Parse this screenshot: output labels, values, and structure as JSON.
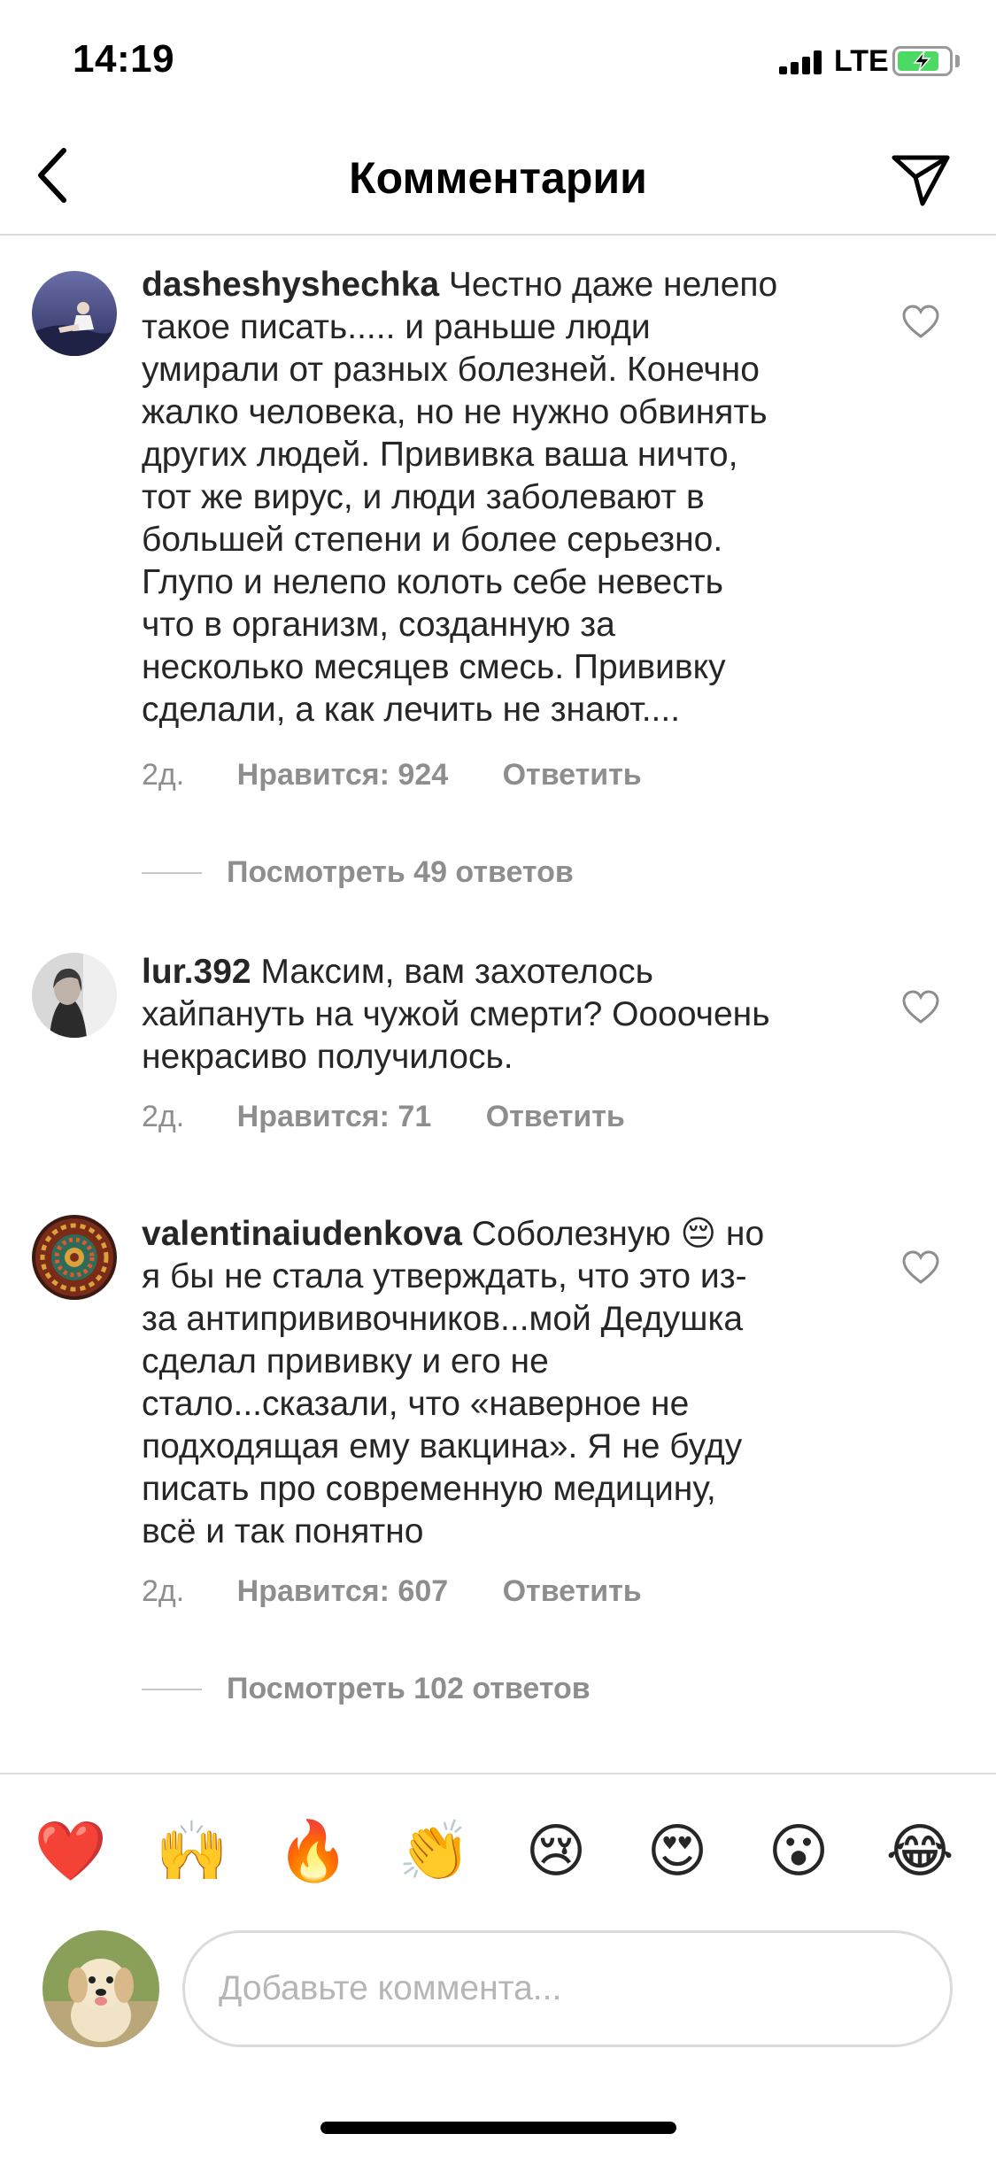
{
  "status_bar": {
    "time": "14:19",
    "network": "LTE"
  },
  "nav": {
    "title": "Комментарии"
  },
  "comments": [
    {
      "username": "dasheshyshechka",
      "lines": [
        "Честно даже нелепо",
        "такое писать..... и раньше люди",
        "умирали от разных болезней. Конечно",
        "жалко человека, но не нужно обвинять",
        "других людей. Прививка ваша ничто,",
        "тот же вирус, и люди заболевают в",
        "большей степени и более серьезно.",
        "Глупо и нелепо колоть себе невесть",
        "что в организм, созданную за",
        "несколько месяцев смесь. Прививку",
        "сделали, а как лечить не знают...."
      ],
      "time": "2д.",
      "likes": "Нравится: 924",
      "reply": "Ответить",
      "view_replies": "Посмотреть 49 ответов"
    },
    {
      "username": "lur.392",
      "lines": [
        "Максим, вам захотелось",
        "хайпануть на чужой смерти? Оооочень",
        "некрасиво получилось."
      ],
      "time": "2д.",
      "likes": "Нравится: 71",
      "reply": "Ответить"
    },
    {
      "username": "valentinaiudenkova",
      "lines": [
        "Соболезную 😔 но",
        "я бы не стала утверждать, что это из-",
        "за антипрививочников...мой Дедушка",
        "сделал прививку и его не",
        "стало...сказали, что «наверное не",
        "подходящая ему вакцина». Я не буду",
        "писать про современную медицину,",
        "всё и так понятно"
      ],
      "time": "2д.",
      "likes": "Нравится: 607",
      "reply": "Ответить",
      "view_replies": "Посмотреть 102 ответов"
    }
  ],
  "emoji_bar": [
    "❤️",
    "🙌",
    "🔥",
    "👏",
    "😢",
    "😍",
    "😮",
    "😂"
  ],
  "compose": {
    "placeholder": "Добавьте коммента..."
  },
  "icons": {
    "back": "chevron-left-icon",
    "send": "paper-plane-icon",
    "like": "heart-outline-icon"
  }
}
